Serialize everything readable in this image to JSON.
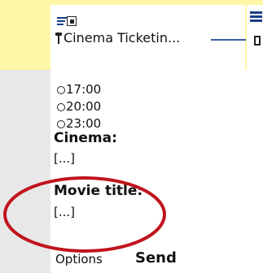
{
  "app": {
    "title": "Cinema Ticketin..."
  },
  "time_options": [
    {
      "label": "17:00",
      "selected": false
    },
    {
      "label": "20:00",
      "selected": false
    },
    {
      "label": "23:00",
      "selected": false
    }
  ],
  "fields": {
    "cinema": {
      "label": "Cinema:",
      "value": "[...]"
    },
    "movie_title": {
      "label": "Movie title:",
      "value": "[...]"
    }
  },
  "softkeys": {
    "left": "Options",
    "center": "Send"
  },
  "icons": {
    "signal": "signal-bars-icon",
    "status": "phone-indicator-icon",
    "antenna": "antenna-icon",
    "radio": "radio-button-icon"
  },
  "colors": {
    "top_band": "#fff7a6",
    "left_strip": "#e8e8e8",
    "accent_blue": "#183e8a",
    "rail_blue": "#123a8a",
    "highlight_red": "#c0141c"
  }
}
